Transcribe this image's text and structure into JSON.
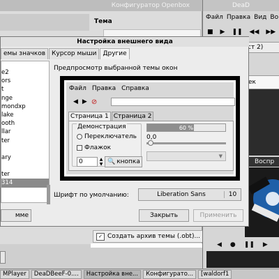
{
  "openbox": {
    "title": "Конфигуратор Openbox",
    "section_theme": "Тема",
    "create_archive": "Создать архив темы (.obt)..."
  },
  "deadbeef": {
    "title": "DeaD",
    "menu": [
      "Файл",
      "Правка",
      "Вид",
      "Во"
    ],
    "tab_label": "ст 2)",
    "seek_label": "ек",
    "video_label": "Воспр"
  },
  "dialog": {
    "title": "Настройка внешнего вида",
    "tabs": [
      "емы значков",
      "Курсор мыши",
      "Другие"
    ],
    "theme_list": [
      "e2",
      "ors",
      "t",
      "nge",
      "mondxp",
      "lake",
      "ooth",
      "llar",
      "ter",
      "",
      "ary",
      "",
      "ter",
      "314"
    ],
    "selected_theme_index": 13,
    "preview_label": "Предпросмотр выбранной темы окон",
    "preview": {
      "menu": [
        "Файл",
        "Правка",
        "Справка"
      ],
      "tabs": [
        "Страница 1",
        "Страница 2"
      ],
      "group_title": "Демонстрация",
      "radio_label": "Переключатель",
      "check_label": "Флажок",
      "spin_value": "0",
      "button_label": "кнопка",
      "progress_text": "60 %",
      "progress_value": 0.6,
      "slider_value": "0,0"
    },
    "font_label": "Шрифт по умолчанию:",
    "font_name": "Liberation Sans",
    "font_size": "10",
    "close_button": "Закрыть",
    "apply_button": "Применить",
    "left_button": "мме"
  },
  "taskbar": {
    "items": [
      "MPlayer",
      "DeaDBeeF-0....",
      "Настройка вне...",
      "Конфигурато...",
      "[waldorf1"
    ]
  }
}
